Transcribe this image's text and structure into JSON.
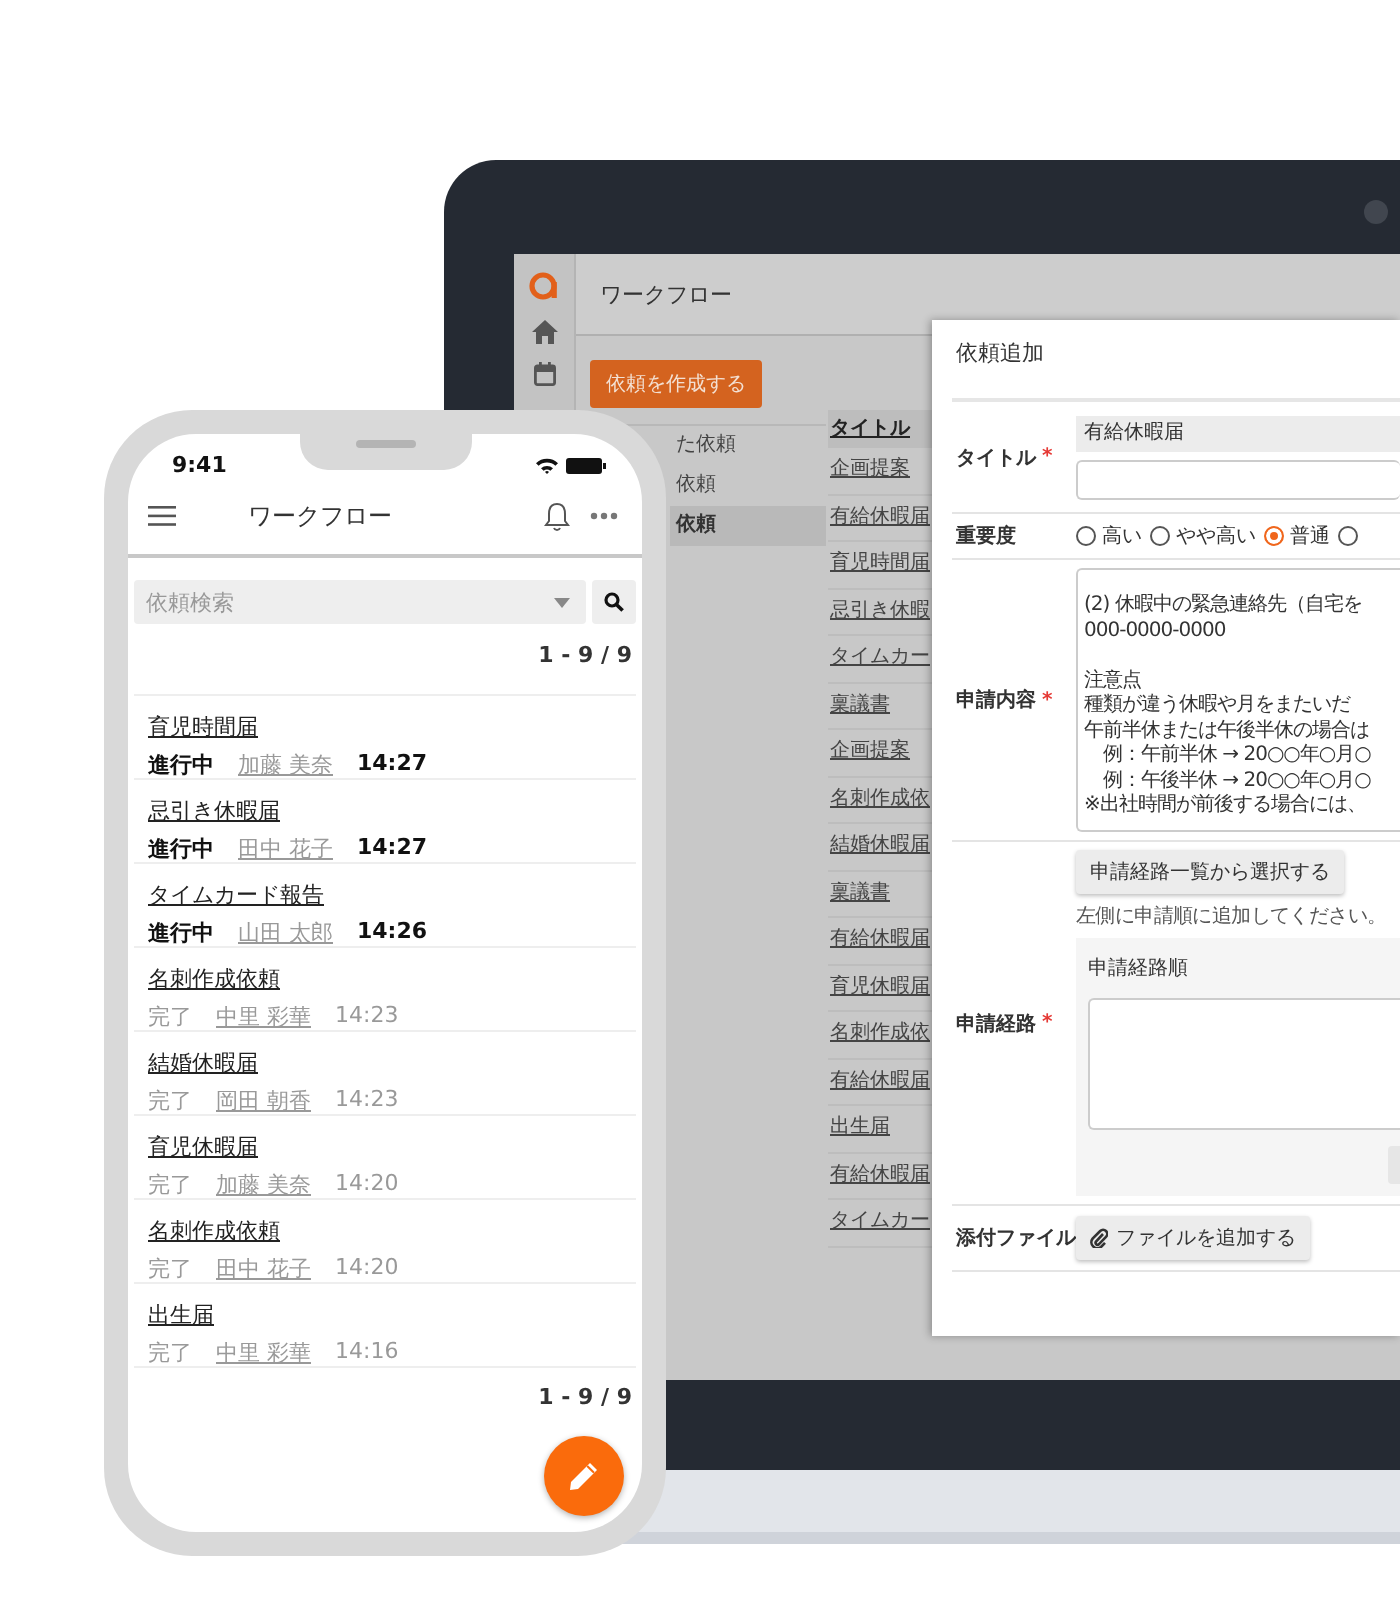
{
  "laptop": {
    "header_title": "ワークフロー",
    "create_button": "依頼を作成する",
    "nav_items": [
      {
        "label": "た依頼",
        "selected": false
      },
      {
        "label": "依頼",
        "selected": false
      },
      {
        "label": "依頼",
        "selected": true
      }
    ],
    "table": {
      "columns": [
        "タイトル"
      ],
      "rows": [
        "企画提案",
        "有給休暇届",
        "育児時間届",
        "忌引き休暇",
        "タイムカー",
        "稟議書",
        "企画提案",
        "名刺作成依",
        "結婚休暇届",
        "稟議書",
        "有給休暇届",
        "育児休暇届",
        "名刺作成依",
        "有給休暇届",
        "出生届",
        "有給休暇届",
        "タイムカー"
      ]
    },
    "dialog": {
      "title": "依頼追加",
      "fields": [
        {
          "kind": "text",
          "label": "タイトル",
          "required_mark": "*",
          "value": "有給休暇届"
        },
        {
          "kind": "radio",
          "label": "重要度",
          "options": [
            {
              "label": "高い",
              "selected": false
            },
            {
              "label": "やや高い",
              "selected": false
            },
            {
              "label": "普通",
              "selected": true
            },
            {
              "selected": false
            }
          ]
        },
        {
          "kind": "textarea",
          "label": "申請内容",
          "required_mark": "*",
          "paragraphs": [
            [
              "(2) 休暇中の緊急連絡先（自宅を",
              "000-0000-0000"
            ],
            [
              "注意点",
              "種類が違う休暇や月をまたいだ",
              "午前半休または午後半休の場合は",
              "　例：午前半休 → 20○○年○月○",
              "　例：午後半休 → 20○○年○月○",
              "※出社時間が前後する場合には、"
            ]
          ]
        },
        {
          "kind": "route",
          "label": "申請経路",
          "required_mark": "*",
          "button": "申請経路一覧から選択する",
          "hint": "左側に申請順に追加してください。",
          "panel_label": "申請経路順"
        },
        {
          "kind": "file",
          "label": "添付ファイル",
          "button": "ファイルを追加する"
        }
      ]
    }
  },
  "phone": {
    "status_time": "9:41",
    "title": "ワークフロー",
    "search": {
      "placeholder": "依頼検索"
    },
    "count_top": "1 - 9 / 9",
    "items": [
      {
        "title": "育児時間届",
        "status": "進行中",
        "name": "加藤 美奈",
        "time": "14:27",
        "in_progress": true
      },
      {
        "title": "忌引き休暇届",
        "status": "進行中",
        "name": "田中 花子",
        "time": "14:27",
        "in_progress": true
      },
      {
        "title": "タイムカード報告",
        "status": "進行中",
        "name": "山田 太郎",
        "time": "14:26",
        "in_progress": true
      },
      {
        "title": "名刺作成依頼",
        "status": "完了",
        "name": "中里 彩華",
        "time": "14:23",
        "in_progress": false
      },
      {
        "title": "結婚休暇届",
        "status": "完了",
        "name": "岡田 朝香",
        "time": "14:23",
        "in_progress": false
      },
      {
        "title": "育児休暇届",
        "status": "完了",
        "name": "加藤 美奈",
        "time": "14:20",
        "in_progress": false
      },
      {
        "title": "名刺作成依頼",
        "status": "完了",
        "name": "田中 花子",
        "time": "14:20",
        "in_progress": false
      },
      {
        "title": "出生届",
        "status": "完了",
        "name": "中里 彩華",
        "time": "14:16",
        "in_progress": false
      }
    ],
    "count_bottom": "1 - 9 / 9"
  }
}
